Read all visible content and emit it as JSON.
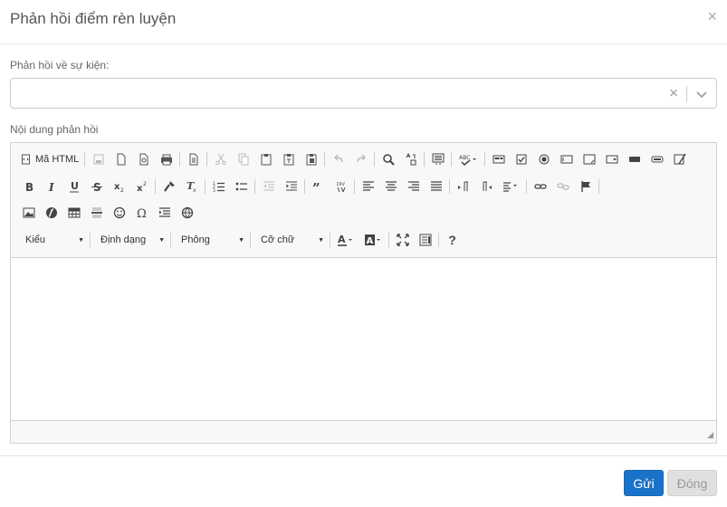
{
  "dialog": {
    "title": "Phản hồi điểm rèn luyện",
    "close_symbol": "×"
  },
  "form": {
    "event_label": "Phản hồi về sự kiện:",
    "event_select": {
      "value": "",
      "clear_symbol": "×"
    },
    "content_label": "Nội dung phản hồi"
  },
  "editor": {
    "source_label": "Mã HTML",
    "combos": {
      "styles": "Kiểu",
      "format": "Định dạng",
      "font": "Phông",
      "size": "Cỡ chữ"
    },
    "help_symbol": "?",
    "resize_symbol": "◢"
  },
  "footer": {
    "send_label": "Gửi",
    "close_label": "Đóng"
  },
  "colors": {
    "primary": "#1a73c8",
    "border": "#d1d1d1",
    "toolbar_bg": "#f8f8f8"
  }
}
